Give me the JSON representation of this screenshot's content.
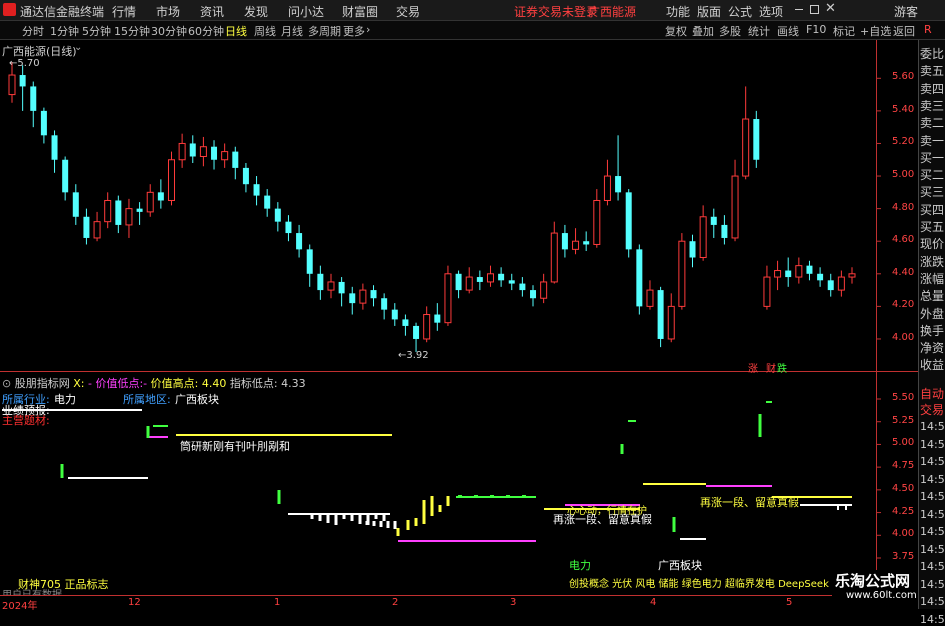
{
  "menubar": {
    "app_title": "通达信金融终端",
    "menus": [
      "行情",
      "市场",
      "资讯",
      "发现",
      "问小达",
      "财富圈",
      "交易"
    ],
    "notice": "证券交易未登录",
    "stock_name": "广西能源",
    "right_menus": [
      "功能",
      "版面",
      "公式",
      "选项"
    ],
    "user": "游客"
  },
  "periodbar": {
    "periods": [
      "分时",
      "1分钟",
      "5分钟",
      "15分钟",
      "30分钟",
      "60分钟",
      "日线",
      "周线",
      "月线",
      "多周期",
      "更多"
    ],
    "active": "日线",
    "tools": [
      "复权",
      "叠加",
      "多股",
      "统计",
      "画线",
      "F10",
      "标记",
      "+自选",
      "返回"
    ],
    "right_flag": "R"
  },
  "main_chart": {
    "title": "广西能源(日线)",
    "high_label": "5.70",
    "low_label": "3.92",
    "y_ticks": [
      "5.60",
      "5.40",
      "5.20",
      "5.00",
      "4.80",
      "4.60",
      "4.40",
      "4.20",
      "4.00"
    ],
    "marker_zhang": "涨",
    "marker_cai": "财",
    "marker_die": "跌",
    "candles": [
      {
        "o": 5.5,
        "c": 5.62,
        "h": 5.7,
        "l": 5.45
      },
      {
        "o": 5.62,
        "c": 5.55,
        "h": 5.68,
        "l": 5.4
      },
      {
        "o": 5.55,
        "c": 5.4,
        "h": 5.58,
        "l": 5.3
      },
      {
        "o": 5.4,
        "c": 5.25,
        "h": 5.42,
        "l": 5.2
      },
      {
        "o": 5.25,
        "c": 5.1,
        "h": 5.28,
        "l": 5.02
      },
      {
        "o": 5.1,
        "c": 4.9,
        "h": 5.12,
        "l": 4.85
      },
      {
        "o": 4.9,
        "c": 4.75,
        "h": 4.95,
        "l": 4.7
      },
      {
        "o": 4.75,
        "c": 4.62,
        "h": 4.8,
        "l": 4.58
      },
      {
        "o": 4.62,
        "c": 4.72,
        "h": 4.78,
        "l": 4.6
      },
      {
        "o": 4.72,
        "c": 4.85,
        "h": 4.9,
        "l": 4.68
      },
      {
        "o": 4.85,
        "c": 4.7,
        "h": 4.88,
        "l": 4.65
      },
      {
        "o": 4.7,
        "c": 4.8,
        "h": 4.86,
        "l": 4.62
      },
      {
        "o": 4.8,
        "c": 4.78,
        "h": 4.84,
        "l": 4.7
      },
      {
        "o": 4.78,
        "c": 4.9,
        "h": 4.95,
        "l": 4.75
      },
      {
        "o": 4.9,
        "c": 4.85,
        "h": 4.98,
        "l": 4.8
      },
      {
        "o": 4.85,
        "c": 5.1,
        "h": 5.15,
        "l": 4.82
      },
      {
        "o": 5.1,
        "c": 5.2,
        "h": 5.26,
        "l": 5.05
      },
      {
        "o": 5.2,
        "c": 5.12,
        "h": 5.25,
        "l": 5.08
      },
      {
        "o": 5.12,
        "c": 5.18,
        "h": 5.24,
        "l": 5.06
      },
      {
        "o": 5.18,
        "c": 5.1,
        "h": 5.22,
        "l": 5.04
      },
      {
        "o": 5.1,
        "c": 5.15,
        "h": 5.2,
        "l": 5.05
      },
      {
        "o": 5.15,
        "c": 5.05,
        "h": 5.18,
        "l": 4.98
      },
      {
        "o": 5.05,
        "c": 4.95,
        "h": 5.08,
        "l": 4.9
      },
      {
        "o": 4.95,
        "c": 4.88,
        "h": 5.0,
        "l": 4.82
      },
      {
        "o": 4.88,
        "c": 4.8,
        "h": 4.92,
        "l": 4.75
      },
      {
        "o": 4.8,
        "c": 4.72,
        "h": 4.84,
        "l": 4.66
      },
      {
        "o": 4.72,
        "c": 4.65,
        "h": 4.76,
        "l": 4.6
      },
      {
        "o": 4.65,
        "c": 4.55,
        "h": 4.7,
        "l": 4.5
      },
      {
        "o": 4.55,
        "c": 4.4,
        "h": 4.58,
        "l": 4.32
      },
      {
        "o": 4.4,
        "c": 4.3,
        "h": 4.45,
        "l": 4.24
      },
      {
        "o": 4.3,
        "c": 4.35,
        "h": 4.4,
        "l": 4.25
      },
      {
        "o": 4.35,
        "c": 4.28,
        "h": 4.38,
        "l": 4.2
      },
      {
        "o": 4.28,
        "c": 4.22,
        "h": 4.32,
        "l": 4.15
      },
      {
        "o": 4.22,
        "c": 4.3,
        "h": 4.34,
        "l": 4.18
      },
      {
        "o": 4.3,
        "c": 4.25,
        "h": 4.33,
        "l": 4.2
      },
      {
        "o": 4.25,
        "c": 4.18,
        "h": 4.28,
        "l": 4.12
      },
      {
        "o": 4.18,
        "c": 4.12,
        "h": 4.22,
        "l": 4.08
      },
      {
        "o": 4.12,
        "c": 4.08,
        "h": 4.15,
        "l": 4.02
      },
      {
        "o": 4.08,
        "c": 4.0,
        "h": 4.1,
        "l": 3.92
      },
      {
        "o": 4.0,
        "c": 4.15,
        "h": 4.2,
        "l": 3.98
      },
      {
        "o": 4.15,
        "c": 4.1,
        "h": 4.22,
        "l": 4.05
      },
      {
        "o": 4.1,
        "c": 4.4,
        "h": 4.45,
        "l": 4.08
      },
      {
        "o": 4.4,
        "c": 4.3,
        "h": 4.42,
        "l": 4.25
      },
      {
        "o": 4.3,
        "c": 4.38,
        "h": 4.44,
        "l": 4.28
      },
      {
        "o": 4.38,
        "c": 4.35,
        "h": 4.42,
        "l": 4.3
      },
      {
        "o": 4.35,
        "c": 4.4,
        "h": 4.45,
        "l": 4.32
      },
      {
        "o": 4.4,
        "c": 4.36,
        "h": 4.44,
        "l": 4.32
      },
      {
        "o": 4.36,
        "c": 4.34,
        "h": 4.4,
        "l": 4.3
      },
      {
        "o": 4.34,
        "c": 4.3,
        "h": 4.38,
        "l": 4.26
      },
      {
        "o": 4.3,
        "c": 4.25,
        "h": 4.33,
        "l": 4.2
      },
      {
        "o": 4.25,
        "c": 4.35,
        "h": 4.4,
        "l": 4.22
      },
      {
        "o": 4.35,
        "c": 4.65,
        "h": 4.72,
        "l": 4.34
      },
      {
        "o": 4.65,
        "c": 4.55,
        "h": 4.7,
        "l": 4.5
      },
      {
        "o": 4.55,
        "c": 4.6,
        "h": 4.68,
        "l": 4.52
      },
      {
        "o": 4.6,
        "c": 4.58,
        "h": 4.66,
        "l": 4.54
      },
      {
        "o": 4.58,
        "c": 4.85,
        "h": 4.92,
        "l": 4.56
      },
      {
        "o": 4.85,
        "c": 5.0,
        "h": 5.1,
        "l": 4.82
      },
      {
        "o": 5.0,
        "c": 4.9,
        "h": 5.25,
        "l": 4.85
      },
      {
        "o": 4.9,
        "c": 4.55,
        "h": 4.92,
        "l": 4.5
      },
      {
        "o": 4.55,
        "c": 4.2,
        "h": 4.58,
        "l": 4.15
      },
      {
        "o": 4.2,
        "c": 4.3,
        "h": 4.36,
        "l": 4.18
      },
      {
        "o": 4.3,
        "c": 4.0,
        "h": 4.32,
        "l": 3.95
      },
      {
        "o": 4.0,
        "c": 4.2,
        "h": 4.28,
        "l": 3.98
      },
      {
        "o": 4.2,
        "c": 4.6,
        "h": 4.65,
        "l": 4.18
      },
      {
        "o": 4.6,
        "c": 4.5,
        "h": 4.64,
        "l": 4.44
      },
      {
        "o": 4.5,
        "c": 4.75,
        "h": 4.82,
        "l": 4.48
      },
      {
        "o": 4.75,
        "c": 4.7,
        "h": 4.8,
        "l": 4.62
      },
      {
        "o": 4.7,
        "c": 4.62,
        "h": 4.76,
        "l": 4.58
      },
      {
        "o": 4.62,
        "c": 5.0,
        "h": 5.1,
        "l": 4.6
      },
      {
        "o": 5.0,
        "c": 5.35,
        "h": 5.55,
        "l": 4.98
      },
      {
        "o": 5.35,
        "c": 5.1,
        "h": 5.4,
        "l": 5.05
      },
      {
        "o": 4.2,
        "c": 4.38,
        "h": 4.45,
        "l": 4.18
      },
      {
        "o": 4.38,
        "c": 4.42,
        "h": 4.48,
        "l": 4.3
      },
      {
        "o": 4.42,
        "c": 4.38,
        "h": 4.5,
        "l": 4.32
      },
      {
        "o": 4.38,
        "c": 4.45,
        "h": 4.5,
        "l": 4.34
      },
      {
        "o": 4.45,
        "c": 4.4,
        "h": 4.48,
        "l": 4.36
      },
      {
        "o": 4.4,
        "c": 4.36,
        "h": 4.44,
        "l": 4.32
      },
      {
        "o": 4.36,
        "c": 4.3,
        "h": 4.4,
        "l": 4.26
      },
      {
        "o": 4.3,
        "c": 4.38,
        "h": 4.42,
        "l": 4.26
      },
      {
        "o": 4.38,
        "c": 4.4,
        "h": 4.44,
        "l": 4.34
      }
    ]
  },
  "indicator": {
    "name": "股朋指标网",
    "x_label": "X",
    "low_label": "价值低点",
    "high_label": "价值高点:",
    "high_value": "4.40",
    "ind_low_label": "指标低点:",
    "ind_low_value": "4.33",
    "industry_label": "所属行业:",
    "industry_value": "电力",
    "region_label": "所属地区:",
    "region_value": "广西板块",
    "report_label": "业绩预报:",
    "theme_label": "主营题材:",
    "overlay_text": "筒研新刚有刊叶刖剐和",
    "band_text1": "再涨一段、留意真假",
    "band_text2": "再涨一段、留意真假",
    "band_text3": "再涨一段、留意真假",
    "mid_text": "心心动，行情在护",
    "sector1": "电力",
    "sector2": "广西板块",
    "concept_line": "创投概念 光伏 风电 储能 绿色电力 超临界发电 DeepSeek",
    "bottom_left": "财神705 正品标志",
    "bottom_sub": "用户已有数据",
    "y_ticks": [
      "5.50",
      "5.25",
      "5.00",
      "4.75",
      "4.50",
      "4.25",
      "4.00",
      "3.75"
    ]
  },
  "right_panel": {
    "items": [
      "委比",
      "卖五",
      "卖四",
      "卖三",
      "卖二",
      "卖一",
      "买一",
      "买二",
      "买三",
      "买四",
      "买五",
      "现价",
      "涨跌",
      "涨幅",
      "总量",
      "外盘",
      "换手",
      "净资",
      "收益",
      "自动",
      "交易"
    ],
    "times": [
      "14:50",
      "14:50",
      "14:5",
      "14:5",
      "14:5",
      "14:5",
      "14:5",
      "14:5",
      "14:5",
      "14:5",
      "14:5",
      "14:5"
    ]
  },
  "xaxis": {
    "labels": [
      "2024年",
      "12",
      "1",
      "2",
      "3",
      "4",
      "5"
    ]
  },
  "watermark": {
    "title": "乐淘公式网",
    "url": "www.60lt.com"
  },
  "colors": {
    "up": "#ff3b3b",
    "down": "#54ffff",
    "yellow": "#ffff40",
    "magenta": "#ff40ff",
    "green": "#40ff40",
    "white": "#ffffff"
  }
}
